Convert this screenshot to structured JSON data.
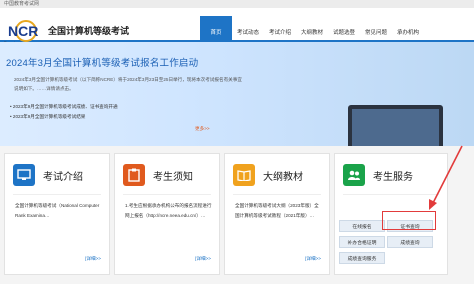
{
  "topbar": {
    "text": "中国教育考试网"
  },
  "header": {
    "logo_text": "NCR",
    "logo_sub": "Examination",
    "site_title": "全国计算机等级考试",
    "nav": [
      "首页",
      "考试动态",
      "考试介绍",
      "大纲教材",
      "试题选登",
      "常见问题",
      "承办机构"
    ],
    "active_nav": "首页"
  },
  "hero": {
    "title": "2024年3月全国计算机等级考试报名工作启动",
    "text": "2024年3月全国计算机等级考试（以下简称NCRE）将于2024年3月23日至25日举行，现将本次考试报名有关事宜说明如下。……详情请点击。",
    "items": [
      "2023年9月全国计算机等级考试成绩、证书查询开通",
      "2023年9月全国计算机等级考试结果"
    ],
    "more": "更多>>"
  },
  "cards": [
    {
      "title": "考试介绍",
      "icon": "monitor-icon",
      "body": "全国计算机等级考试（National Computer Rank Examina…",
      "more": "[详细>>"
    },
    {
      "title": "考生须知",
      "icon": "clipboard-icon",
      "body": "1.考生应根据承办机构公布的报名流程进行网上报名（http://ncre.neea.edu.cn/）…",
      "more": "[详细>>"
    },
    {
      "title": "大纲教材",
      "icon": "book-icon",
      "body": "全国计算机等级考试大纲（2023年版）全国计算机等级考试教程（2021年版）…",
      "more": "[详细>>"
    },
    {
      "title": "考生服务",
      "icon": "people-icon",
      "buttons": [
        "在线报名",
        "证书查询",
        "补办合格证明",
        "成绩查询",
        "成绩查询服务"
      ]
    }
  ],
  "colors": {
    "primary": "#1e74c6",
    "highlight": "#e23b3b",
    "accent": "#e05a1e"
  }
}
